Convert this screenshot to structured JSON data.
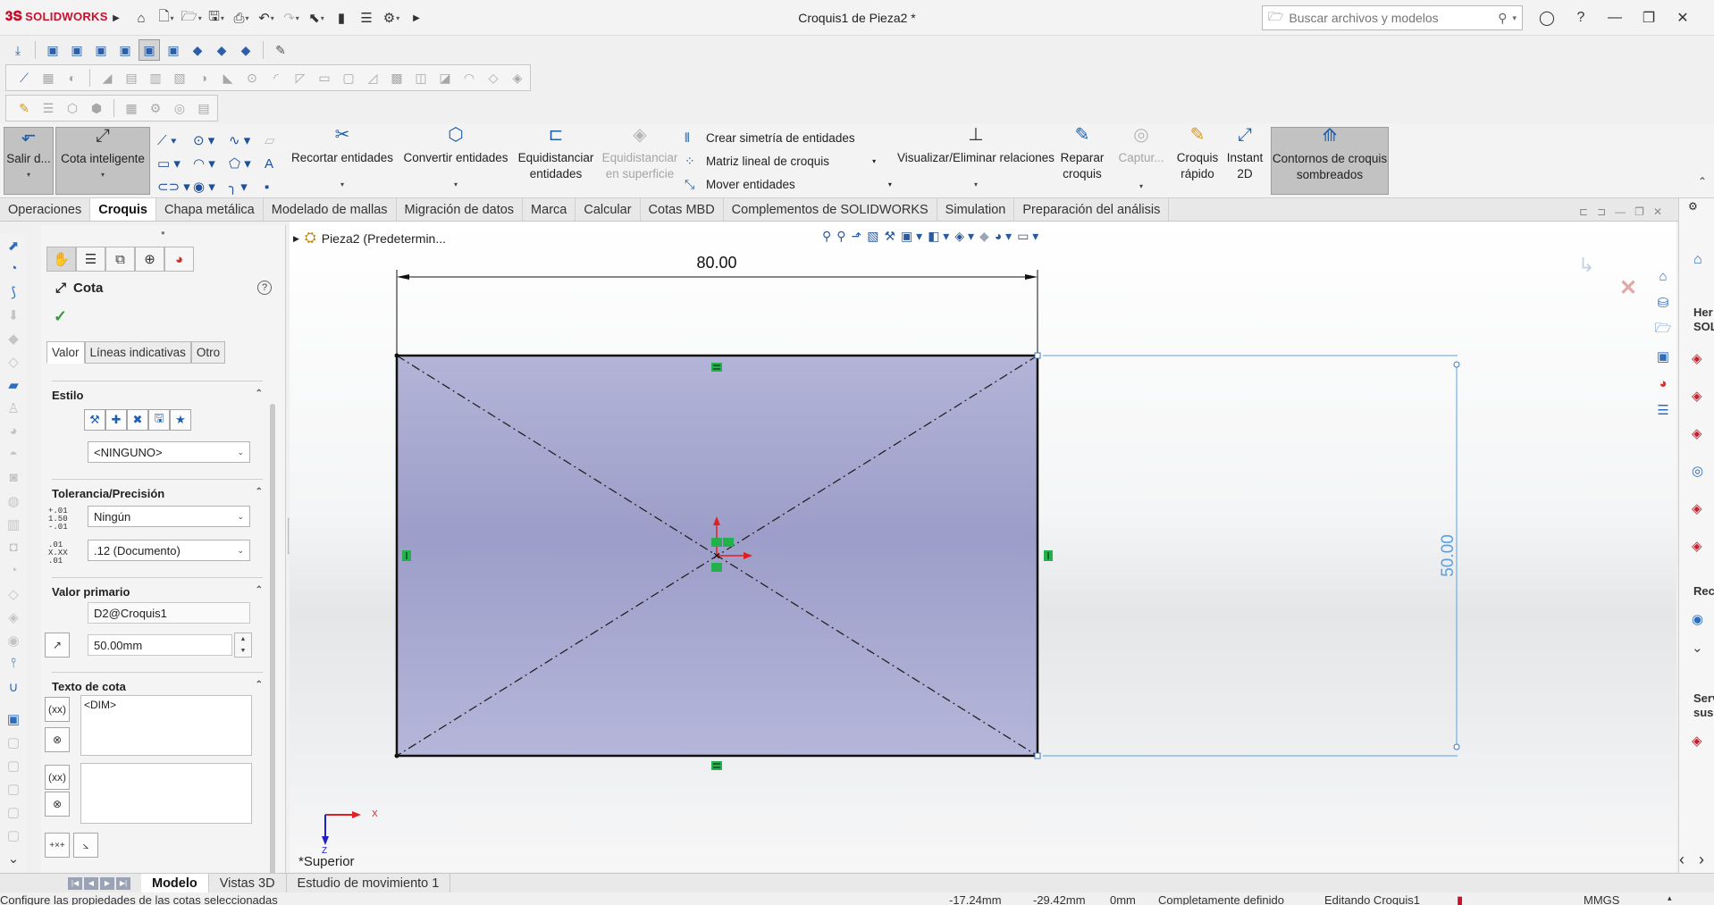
{
  "app": {
    "brand": "SOLIDWORKS",
    "document_title": "Croquis1 de Pieza2 *"
  },
  "search": {
    "placeholder": "Buscar archivos y modelos"
  },
  "command_manager": {
    "exit_sketch": "Salir d...",
    "smart_dimension": "Cota inteligente",
    "trim": "Recortar entidades",
    "convert": "Convertir entidades",
    "offset": "Equidistanciar entidades",
    "offset_surface": "Equidistanciar en superficie",
    "mirror": "Crear simetría de entidades",
    "linear_pattern": "Matriz lineal de croquis",
    "move": "Mover entidades",
    "relations": "Visualizar/Eliminar relaciones",
    "repair": "Reparar croquis",
    "capture": "Captur...",
    "quick_sketch": "Croquis rápido",
    "instant2d": "Instant 2D",
    "shaded_contours": "Contornos de croquis sombreados"
  },
  "tabs": [
    "Operaciones",
    "Croquis",
    "Chapa metálica",
    "Modelado de mallas",
    "Migración de datos",
    "Marca",
    "Calcular",
    "Cotas MBD",
    "Complementos de SOLIDWORKS",
    "Simulation",
    "Preparación del análisis"
  ],
  "active_tab": "Croquis",
  "property_manager": {
    "title": "Cota",
    "subtabs": [
      "Valor",
      "Líneas indicativas",
      "Otro"
    ],
    "style_header": "Estilo",
    "style_value": "<NINGUNO>",
    "tolerance_header": "Tolerancia/Precisión",
    "tolerance_value": "Ningún",
    "precision_value": ".12 (Documento)",
    "primary_header": "Valor primario",
    "dimension_name": "D2@Croquis1",
    "dimension_value": "50.00mm",
    "text_header": "Texto de cota",
    "dim_text": "<DIM>",
    "tol_icon_top": "1.50",
    "tol_icon_mid": "+.01",
    "tol_icon_bot": "-.01",
    "prec_icon_top": ".01",
    "prec_icon_mid": "X.XX",
    "prec_icon_bot": ".01"
  },
  "viewport": {
    "tree_item": "Pieza2 (Predetermin...",
    "view_name": "*Superior",
    "dim_horizontal": "80.00",
    "dim_vertical": "50.00",
    "axis_x": "X",
    "axis_z": "Z"
  },
  "right_panel": {
    "label1a": "Her",
    "label1b": "SOLI",
    "label2": "Reci",
    "label3a": "Serv",
    "label3b": "susc"
  },
  "bottom_tabs": [
    "Modelo",
    "Vistas 3D",
    "Estudio de movimiento 1"
  ],
  "active_bottom_tab": "Modelo",
  "status": {
    "message": "Configure las propiedades de las cotas seleccionadas",
    "x": "-17.24mm",
    "y": "-29.42mm",
    "z": "0mm",
    "state": "Completamente definido",
    "editing": "Editando Croquis1",
    "units": "MMGS"
  },
  "colors": {
    "sketch_fill": "#a3a5cd",
    "dimension_blue": "#5aa0e6",
    "relation_green": "#22b14c",
    "accent_red": "#c8102e"
  }
}
